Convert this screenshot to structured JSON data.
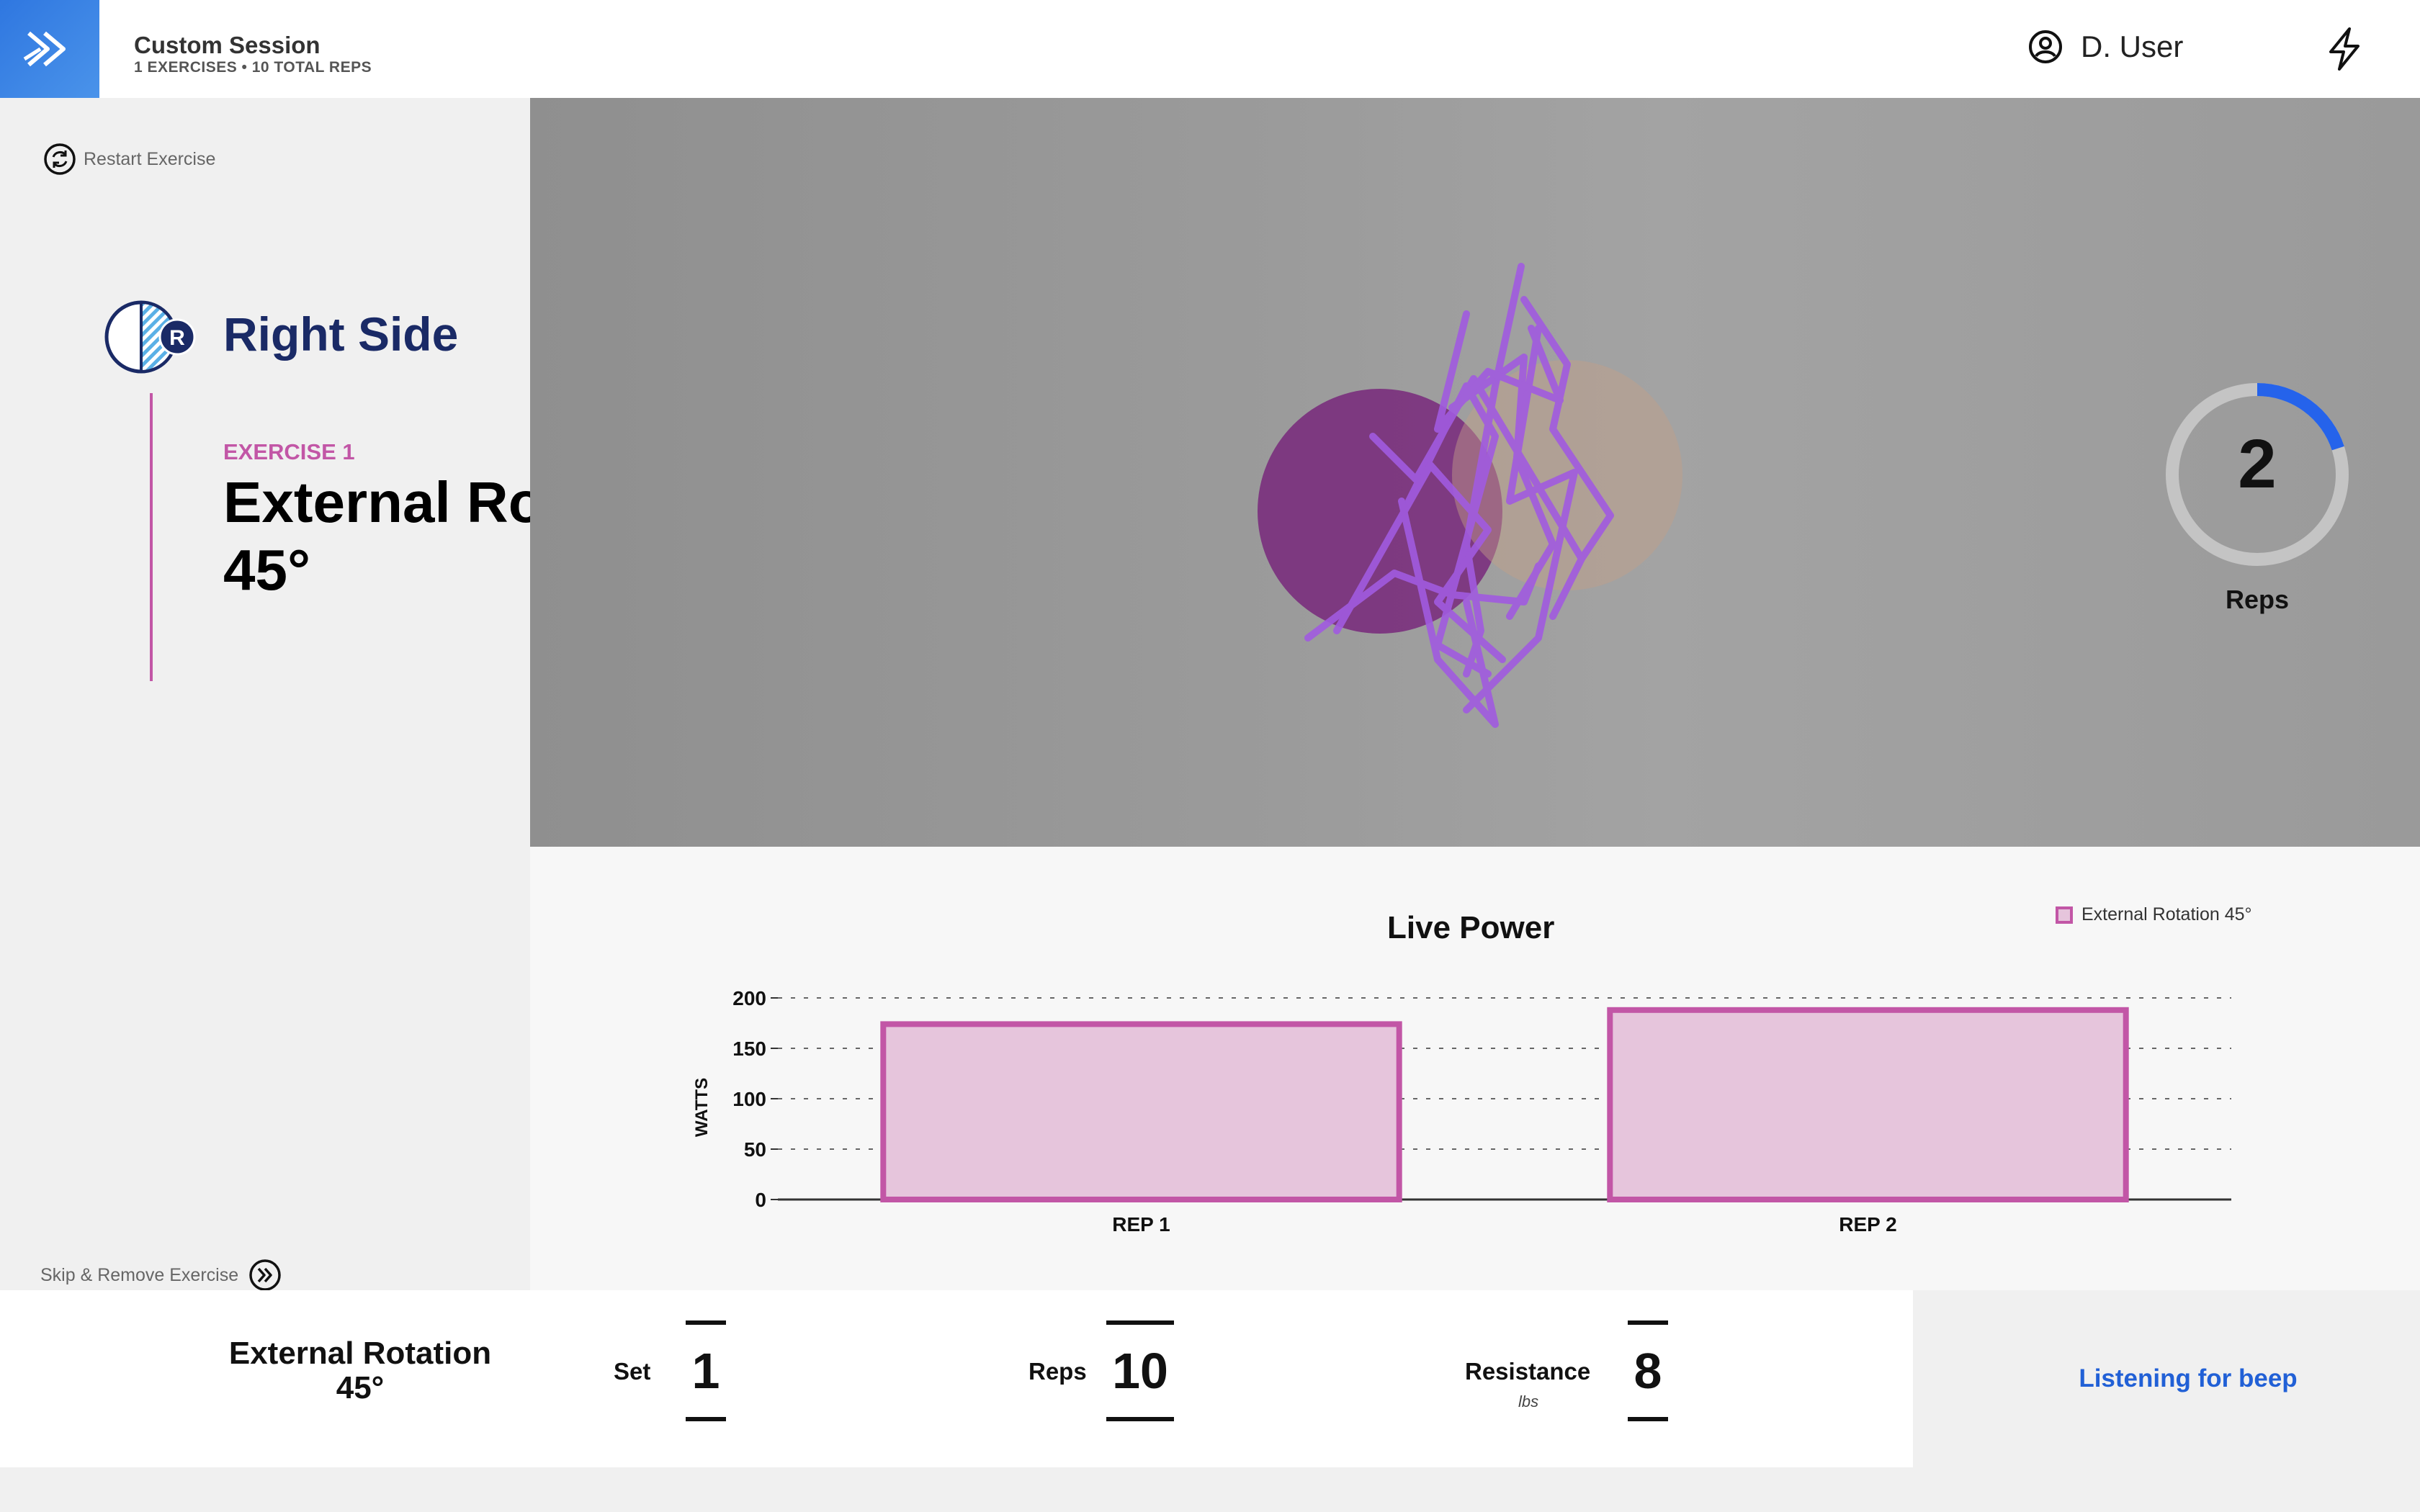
{
  "header": {
    "session_title": "Custom Session",
    "session_subtitle": "1 EXERCISES • 10 TOTAL REPS",
    "user_name": "D. User"
  },
  "left_panel": {
    "restart_label": "Restart Exercise",
    "side_badge_letter": "R",
    "side_label": "Right Side",
    "exercise_number": "EXERCISE 1",
    "exercise_name_line1": "External Rotation",
    "exercise_name_line2": "45°",
    "skip_label": "Skip & Remove Exercise"
  },
  "rep_counter": {
    "value": "2",
    "label": "Reps",
    "progress": 0.2
  },
  "chart_data": {
    "type": "bar",
    "title": "Live Power",
    "categories": [
      "REP 1",
      "REP 2"
    ],
    "series": [
      {
        "name": "External Rotation 45°",
        "values": [
          174,
          188
        ]
      }
    ],
    "ylabel": "WATTS",
    "ylim": [
      0,
      200
    ],
    "yticks": [
      0,
      50,
      100,
      150,
      200
    ],
    "grid": true,
    "legend_position": "top-right",
    "colors": {
      "bar_fill": "#e6c5dc",
      "bar_stroke": "#c256a6"
    }
  },
  "footer": {
    "exercise_line1": "External Rotation",
    "exercise_line2": "45°",
    "set_label": "Set",
    "set_value": "1",
    "reps_label": "Reps",
    "reps_value": "10",
    "resistance_label": "Resistance",
    "resistance_unit": "lbs",
    "resistance_value": "8",
    "status_label": "Listening for beep"
  },
  "colors": {
    "accent_blue": "#2f77e0",
    "accent_pink": "#c256a6",
    "navy": "#1a2a66",
    "status_blue": "#2160d6"
  },
  "icons": {
    "logo": "double-chevron-right-icon",
    "user": "user-circle-icon",
    "power": "lightning-icon",
    "restart": "refresh-icon",
    "skip": "skip-forward-icon"
  }
}
